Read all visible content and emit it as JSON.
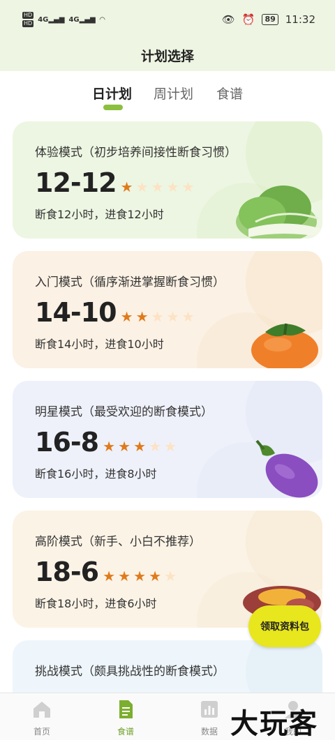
{
  "status_bar": {
    "network_left": "4G",
    "network_right": "4G",
    "hd": "HD",
    "battery": "89",
    "time": "11:32"
  },
  "header": {
    "title": "计划选择"
  },
  "tabs": [
    {
      "label": "日计划",
      "active": true
    },
    {
      "label": "周计划",
      "active": false
    },
    {
      "label": "食谱",
      "active": false
    }
  ],
  "plans": [
    {
      "desc": "体验模式（初步培养间接性断食习惯）",
      "code": "12-12",
      "rating": 1,
      "max_rating": 5,
      "sub": "断食12小时，进食12小时",
      "bg": "#edf6e2",
      "accent": "#d6ebbc",
      "veg": "bok-choy-icon"
    },
    {
      "desc": "入门模式（循序渐进掌握断食习惯）",
      "code": "14-10",
      "rating": 2,
      "max_rating": 5,
      "sub": "断食14小时，进食10小时",
      "bg": "#fbf1e4",
      "accent": "#f6e0c0",
      "veg": "persimmon-icon"
    },
    {
      "desc": "明星模式（最受欢迎的断食模式）",
      "code": "16-8",
      "rating": 3,
      "max_rating": 5,
      "sub": "断食16小时，进食8小时",
      "bg": "#eef1fa",
      "accent": "#dce2f4",
      "veg": "eggplant-icon"
    },
    {
      "desc": "高阶模式（新手、小白不推荐）",
      "code": "18-6",
      "rating": 4,
      "max_rating": 5,
      "sub": "断食18小时，进食6小时",
      "bg": "#fbf3e6",
      "accent": "#f5e3c6",
      "veg": "sweet-potato-icon"
    },
    {
      "desc": "挑战模式（颇具挑战性的断食模式）",
      "code": "",
      "rating": 0,
      "max_rating": 5,
      "sub": "",
      "bg": "#eef6fb",
      "accent": "#dbeaf4",
      "veg": ""
    }
  ],
  "gift_button": "领取资料包",
  "bottom_nav": [
    {
      "label": "首页",
      "icon": "home-icon",
      "active": false
    },
    {
      "label": "食谱",
      "icon": "document-icon",
      "active": true
    },
    {
      "label": "数据",
      "icon": "chart-icon",
      "active": false
    },
    {
      "label": "我的",
      "icon": "profile-icon",
      "active": false
    }
  ],
  "watermark": "大玩客"
}
